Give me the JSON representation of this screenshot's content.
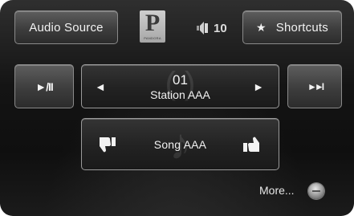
{
  "header": {
    "audio_source_label": "Audio Source",
    "shortcuts_label": "Shortcuts",
    "shortcuts_icon": "★",
    "pandora_logo_letter": "P",
    "pandora_logo_word": "PANDORA",
    "volume_level": "10"
  },
  "controls": {
    "play_pause_icon": "►/II",
    "next_icon": "►►I",
    "prev_arrow": "◄",
    "next_arrow": "►"
  },
  "station": {
    "number": "01",
    "name": "Station AAA"
  },
  "song": {
    "name": "Song AAA"
  },
  "footer": {
    "more_label": "More..."
  },
  "icons": {
    "speaker": "speaker-icon",
    "note": "music-note-icon",
    "thumbs_down": "thumbs-down-icon",
    "thumbs_up": "thumbs-up-icon"
  }
}
